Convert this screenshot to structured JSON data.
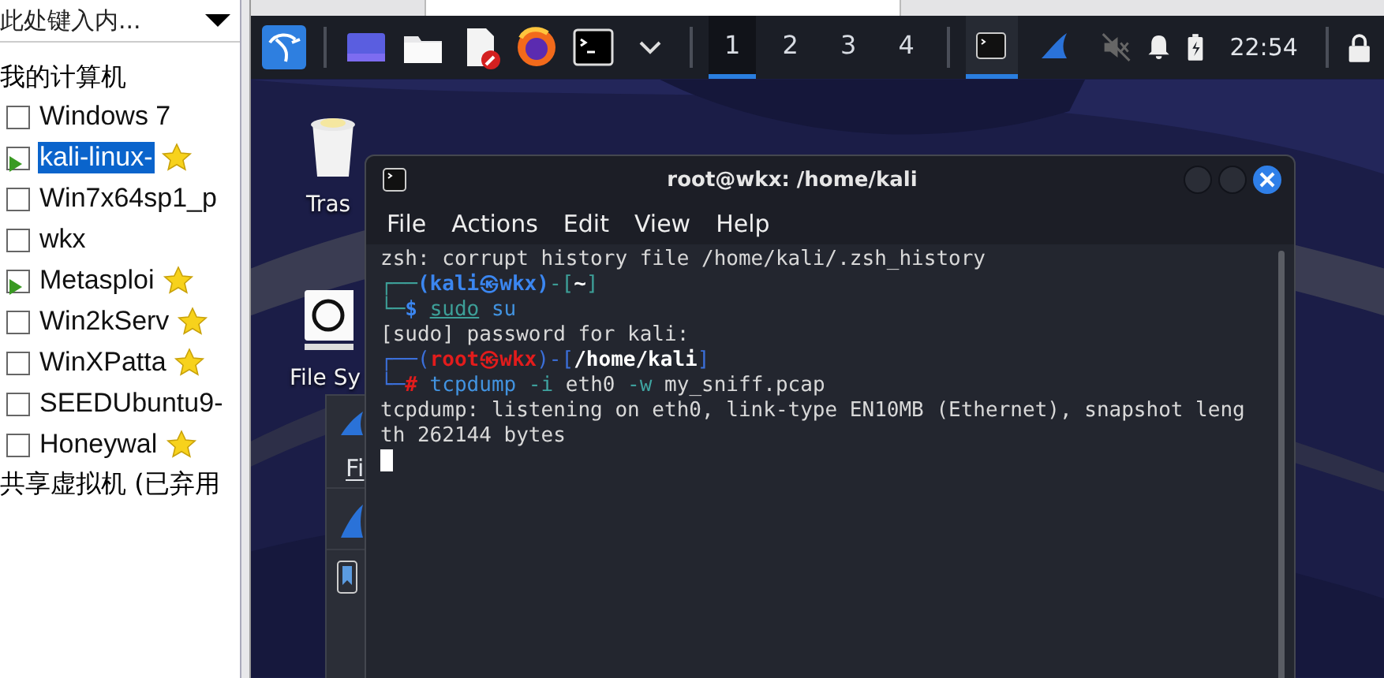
{
  "library": {
    "search": {
      "placeholder": "此处键入内..."
    },
    "tree": {
      "label": "我的计算机",
      "children": [
        {
          "label": "Windows 7",
          "running": false,
          "favorite": false,
          "selected": false
        },
        {
          "label": "kali-linux-",
          "running": true,
          "favorite": true,
          "selected": true
        },
        {
          "label": "Win7x64sp1_p",
          "running": false,
          "favorite": false,
          "selected": false
        },
        {
          "label": "wkx",
          "running": false,
          "favorite": false,
          "selected": false
        },
        {
          "label": "Metasploi",
          "running": true,
          "favorite": true,
          "selected": false
        },
        {
          "label": "Win2kServ",
          "running": false,
          "favorite": true,
          "selected": false
        },
        {
          "label": "WinXPatta",
          "running": false,
          "favorite": true,
          "selected": false
        },
        {
          "label": "SEEDUbuntu9-",
          "running": false,
          "favorite": false,
          "selected": false
        },
        {
          "label": "Honeywal",
          "running": false,
          "favorite": true,
          "selected": false
        }
      ]
    },
    "shared": "共享虚拟机 (已弃用"
  },
  "panel": {
    "launchers": [
      {
        "kind": "kali"
      },
      {
        "kind": "workspace"
      },
      {
        "kind": "folder"
      },
      {
        "kind": "editor"
      },
      {
        "kind": "browser"
      },
      {
        "kind": "terminal"
      },
      {
        "kind": "chevron"
      }
    ],
    "workspaces": [
      {
        "label": "1",
        "selected": true
      },
      {
        "label": "2",
        "selected": false
      },
      {
        "label": "3",
        "selected": false
      },
      {
        "label": "4",
        "selected": false
      }
    ],
    "tasks": [
      {
        "kind": "terminal",
        "selected": true
      },
      {
        "kind": "wireshark",
        "selected": false
      }
    ],
    "clock": "22:54"
  },
  "desktop": {
    "icons": [
      {
        "kind": "trash",
        "label": "Tras"
      },
      {
        "kind": "drive",
        "label": "File Sy"
      }
    ]
  },
  "wireshark": {
    "menu": [
      "Fi"
    ]
  },
  "terminal": {
    "title": "root@wkx: /home/kali",
    "menu": [
      "File",
      "Actions",
      "Edit",
      "View",
      "Help"
    ],
    "lines": [
      [
        {
          "text": "zsh: corrupt history file /home/kali/.zsh_history",
          "kind": "plain"
        }
      ],
      [
        {
          "text": "┌──",
          "kind": "teal"
        },
        {
          "text": "(kali㉿wkx)",
          "kind": "blue"
        },
        {
          "text": "-[",
          "kind": "teal"
        },
        {
          "text": "~",
          "kind": "bold"
        },
        {
          "text": "]",
          "kind": "teal"
        }
      ],
      [
        {
          "text": "└─",
          "kind": "teal"
        },
        {
          "text": "$ ",
          "kind": "blue"
        },
        {
          "text": "sudo",
          "kind": "under"
        },
        {
          "text": " su",
          "kind": "cmd"
        }
      ],
      [
        {
          "text": "[sudo] password for kali:",
          "kind": "plain"
        }
      ],
      [
        {
          "text": "┌──(",
          "kind": "frame"
        },
        {
          "text": "root㉿wkx",
          "kind": "red"
        },
        {
          "text": ")-[",
          "kind": "frame"
        },
        {
          "text": "/home/kali",
          "kind": "bold"
        },
        {
          "text": "]",
          "kind": "frame"
        }
      ],
      [
        {
          "text": "└─",
          "kind": "frame"
        },
        {
          "text": "#",
          "kind": "red"
        },
        {
          "text": " tcpdump",
          "kind": "cmd"
        },
        {
          "text": " -i",
          "kind": "flag"
        },
        {
          "text": " eth0",
          "kind": "plain"
        },
        {
          "text": " -w",
          "kind": "flag"
        },
        {
          "text": " my_sniff.pcap",
          "kind": "plain"
        }
      ],
      [
        {
          "text": "tcpdump: listening on eth0, link-type EN10MB (Ethernet), snapshot leng",
          "kind": "plain"
        }
      ],
      [
        {
          "text": "th 262144 bytes",
          "kind": "plain"
        }
      ]
    ]
  }
}
